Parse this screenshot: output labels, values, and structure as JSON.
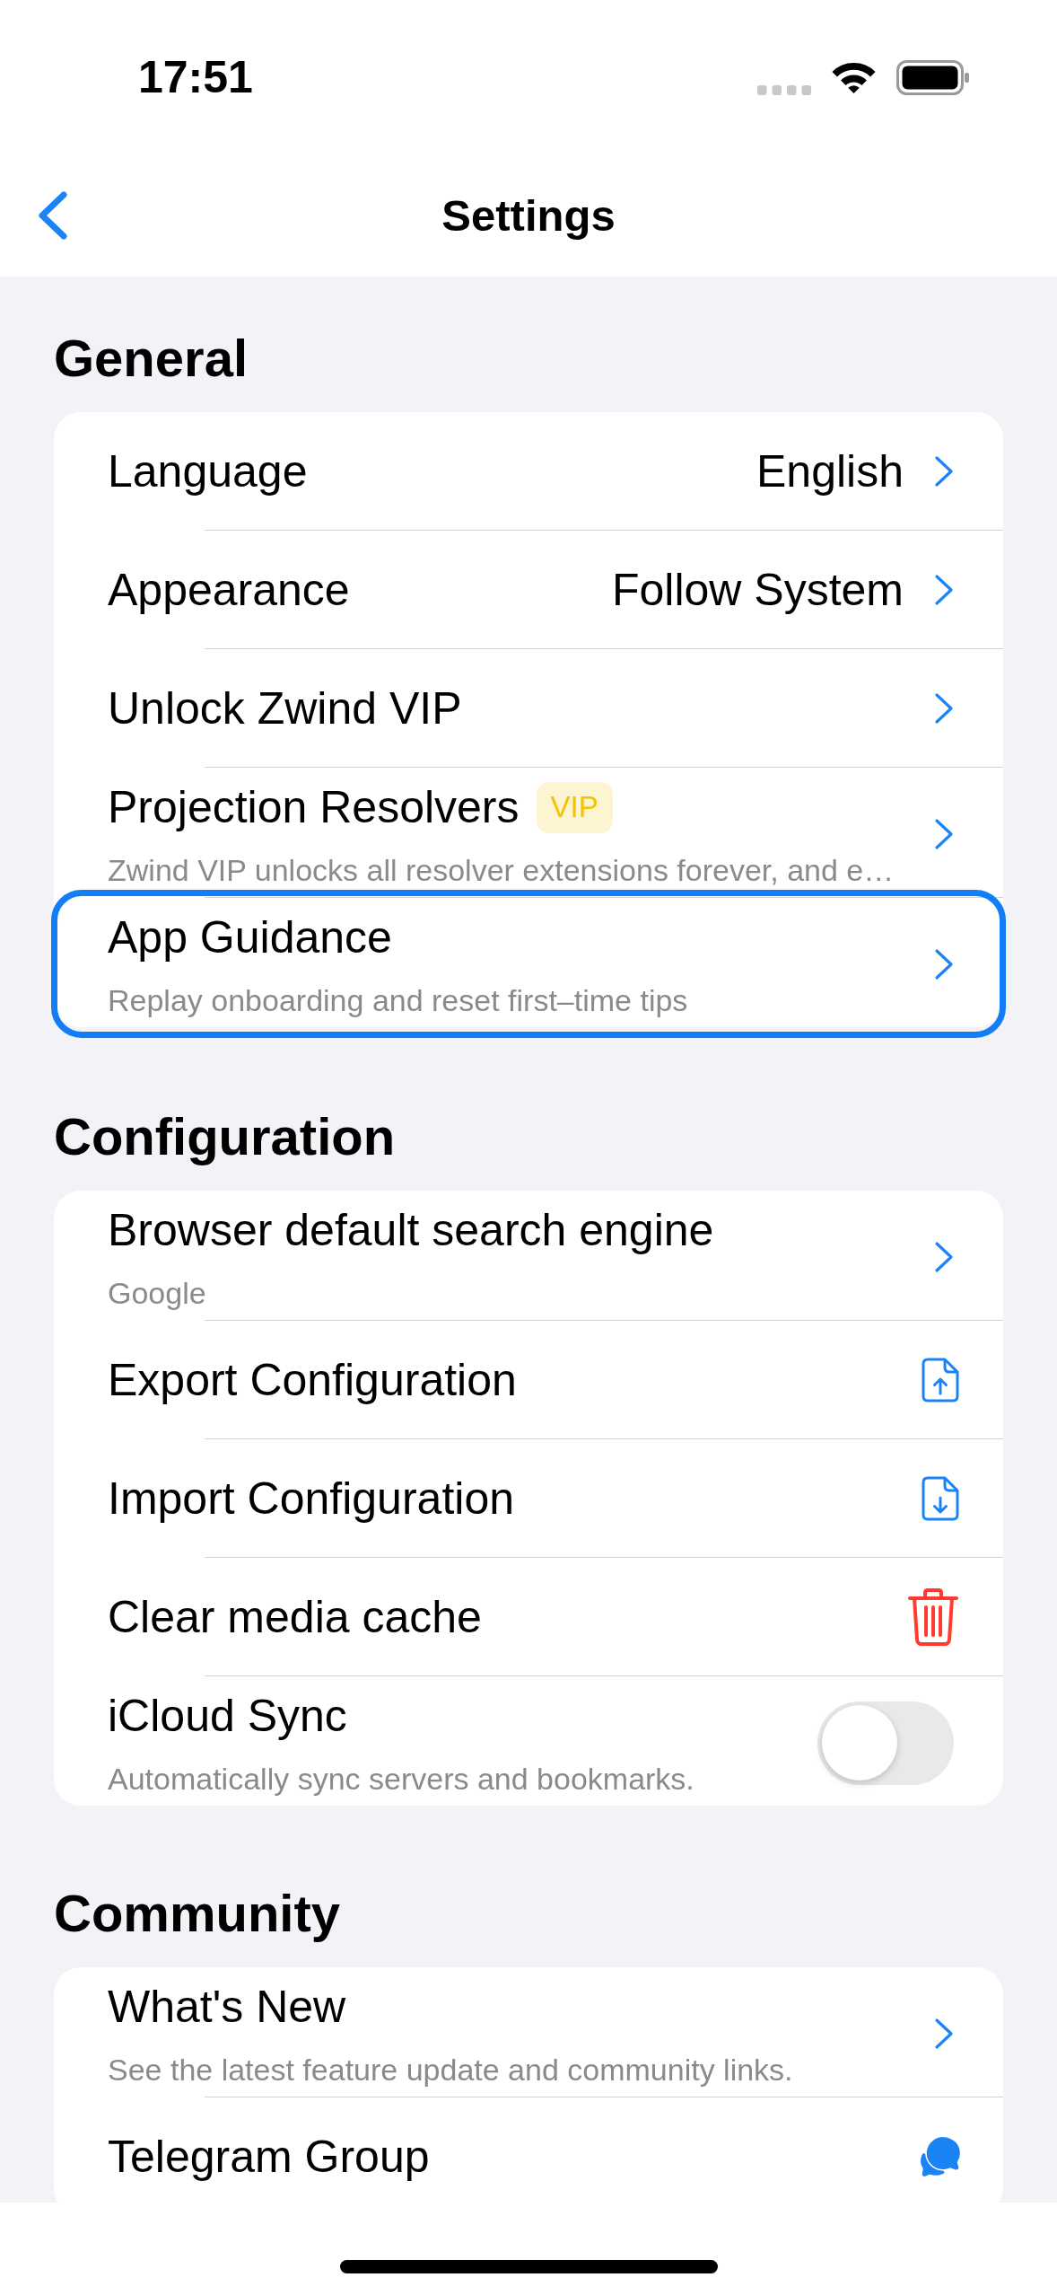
{
  "status_bar": {
    "time": "17:51"
  },
  "nav": {
    "title": "Settings"
  },
  "sections": [
    {
      "title": "General",
      "items": [
        {
          "kind": "link",
          "label": "Language",
          "value": "English",
          "highlighted": false
        },
        {
          "kind": "link",
          "label": "Appearance",
          "value": "Follow System",
          "highlighted": false
        },
        {
          "kind": "link",
          "label": "Unlock Zwind VIP",
          "highlighted": false
        },
        {
          "kind": "link",
          "label": "Projection Resolvers",
          "badge": "VIP",
          "subtitle": "Zwind VIP unlocks all resolver extensions forever, and e…",
          "highlighted": false
        },
        {
          "kind": "link",
          "label": "App Guidance",
          "subtitle": "Replay onboarding and reset first–time tips",
          "highlighted": true
        }
      ]
    },
    {
      "title": "Configuration",
      "items": [
        {
          "kind": "link",
          "label": "Browser default search engine",
          "subtitle": "Google"
        },
        {
          "kind": "export",
          "label": "Export Configuration"
        },
        {
          "kind": "import",
          "label": "Import Configuration"
        },
        {
          "kind": "delete",
          "label": "Clear media cache"
        },
        {
          "kind": "toggle",
          "label": "iCloud Sync",
          "subtitle": "Automatically sync servers and bookmarks.",
          "on": false
        }
      ]
    },
    {
      "title": "Community",
      "items": [
        {
          "kind": "link",
          "label": "What's New",
          "subtitle": "See the latest feature update and community links."
        },
        {
          "kind": "chat",
          "label": "Telegram Group"
        }
      ]
    }
  ]
}
